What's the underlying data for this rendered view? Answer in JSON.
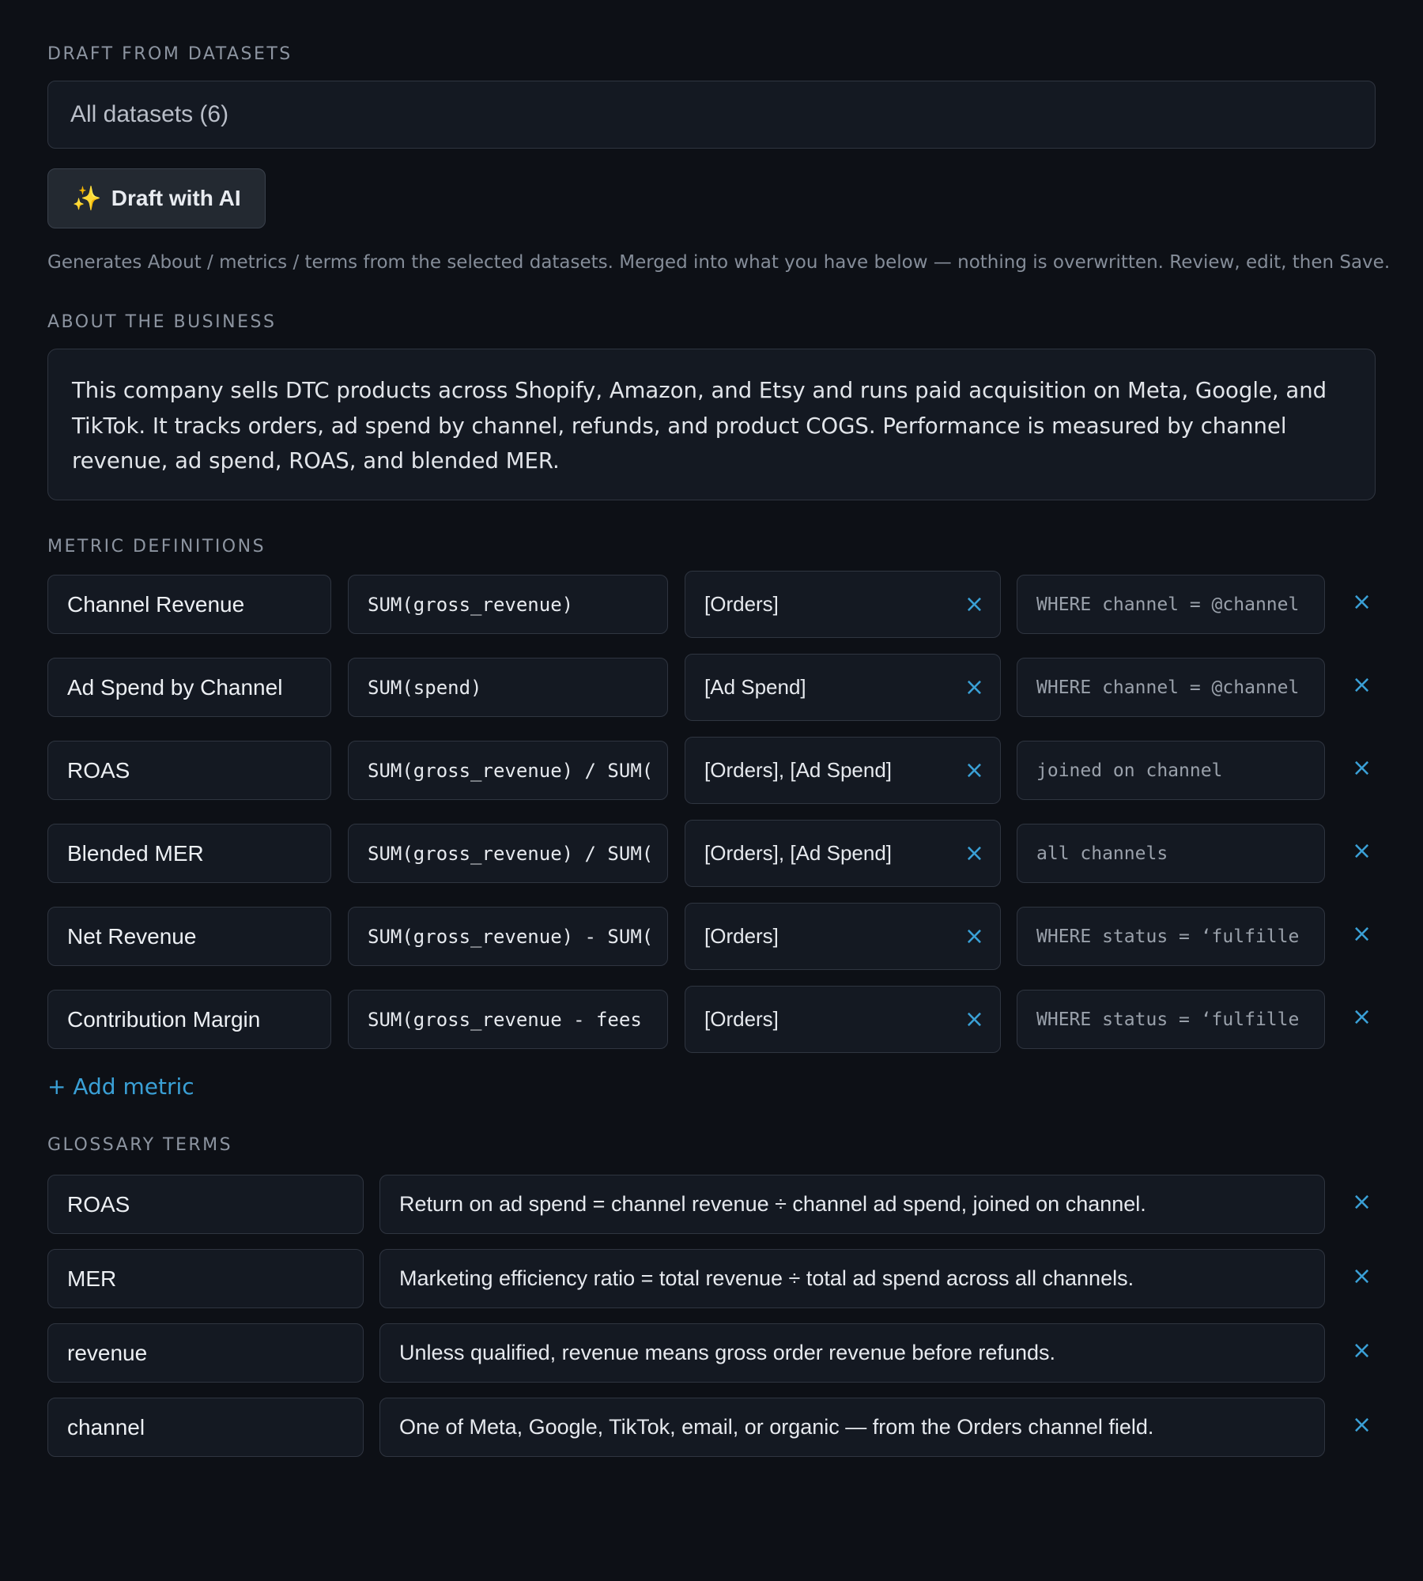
{
  "draft": {
    "section_label": "DRAFT FROM DATASETS",
    "dataset_select_value": "All datasets (6)",
    "ai_button_icon": "sparkles",
    "ai_button_label": "Draft with AI",
    "helper_text": "Generates About / metrics / terms from the selected datasets. Merged into what you have below — nothing is overwritten. Review, edit, then Save."
  },
  "about": {
    "section_label": "ABOUT THE BUSINESS",
    "text": "This company sells DTC products across Shopify, Amazon, and Etsy and runs paid acquisition on Meta, Google, and TikTok. It tracks orders, ad spend by channel, refunds, and product COGS. Performance is measured by channel revenue, ad spend, ROAS, and blended MER."
  },
  "metrics": {
    "section_label": "METRIC DEFINITIONS",
    "add_label": "+ Add metric",
    "remove_glyph": "×",
    "items": [
      {
        "name": "Channel Revenue",
        "expression": "SUM(gross_revenue)",
        "datasets": "[Orders]",
        "filter": "WHERE channel = @channel"
      },
      {
        "name": "Ad Spend by Channel",
        "expression": "SUM(spend)",
        "datasets": "[Ad Spend]",
        "filter": "WHERE channel = @channel"
      },
      {
        "name": "ROAS",
        "expression": "SUM(gross_revenue) / SUM(",
        "datasets": "[Orders], [Ad Spend]",
        "filter": "joined on channel"
      },
      {
        "name": "Blended MER",
        "expression": "SUM(gross_revenue) / SUM(",
        "datasets": "[Orders], [Ad Spend]",
        "filter": "all channels"
      },
      {
        "name": "Net Revenue",
        "expression": "SUM(gross_revenue) - SUM(",
        "datasets": "[Orders]",
        "filter": "WHERE status = ‘fulfille"
      },
      {
        "name": "Contribution Margin",
        "expression": "SUM(gross_revenue - fees",
        "datasets": "[Orders]",
        "filter": "WHERE status = ‘fulfille"
      }
    ]
  },
  "glossary": {
    "section_label": "GLOSSARY TERMS",
    "remove_glyph": "×",
    "items": [
      {
        "term": "ROAS",
        "definition": "Return on ad spend = channel revenue ÷ channel ad spend, joined on channel."
      },
      {
        "term": "MER",
        "definition": "Marketing efficiency ratio = total revenue ÷ total ad spend across all channels."
      },
      {
        "term": "revenue",
        "definition": "Unless qualified, revenue means gross order revenue before refunds."
      },
      {
        "term": "channel",
        "definition": "One of Meta, Google, TikTok, email, or organic — from the Orders channel field."
      }
    ]
  },
  "colors": {
    "background": "#0d1016",
    "field_background": "#141922",
    "border": "#2f3540",
    "accent": "#3aa0d6",
    "label": "#8d95a1"
  }
}
